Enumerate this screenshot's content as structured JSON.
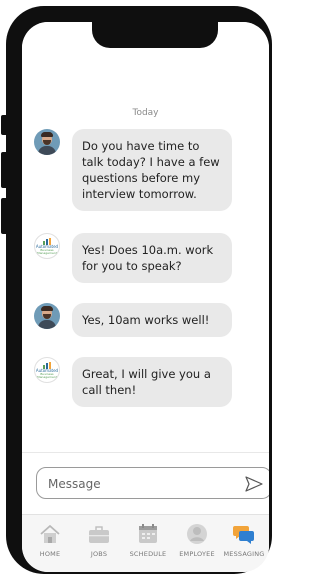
{
  "chat": {
    "date_label": "Today",
    "messages": [
      {
        "sender": "candidate",
        "avatar": "person-avatar",
        "text": "Do you have time to talk today? I have a few questions before my interview tomorrow."
      },
      {
        "sender": "company",
        "avatar": "company-logo-avatar",
        "text": "Yes! Does 10a.m. work for you to speak?"
      },
      {
        "sender": "candidate",
        "avatar": "person-avatar",
        "text": "Yes, 10am works well!"
      },
      {
        "sender": "company",
        "avatar": "company-logo-avatar",
        "text": "Great, I will give you a call then!"
      }
    ],
    "logo_text": "Automated",
    "logo_subtext": "Business Management"
  },
  "compose": {
    "placeholder": "Message",
    "send_icon": "send-icon"
  },
  "tabbar": {
    "tabs": [
      {
        "label": "HOME",
        "icon": "home-icon"
      },
      {
        "label": "JOBS",
        "icon": "briefcase-icon"
      },
      {
        "label": "SCHEDULE",
        "icon": "calendar-icon"
      },
      {
        "label": "EMPLOYEE",
        "icon": "employee-icon"
      },
      {
        "label": "MESSAGING",
        "icon": "chat-bubbles-icon",
        "active": true
      }
    ]
  },
  "colors": {
    "bubble": "#e9e9e9",
    "phone_frame": "#0f0f0f",
    "tab_inactive": "#c9c9c9",
    "messaging_orange": "#f2a43a",
    "messaging_blue": "#2f7fd0"
  }
}
